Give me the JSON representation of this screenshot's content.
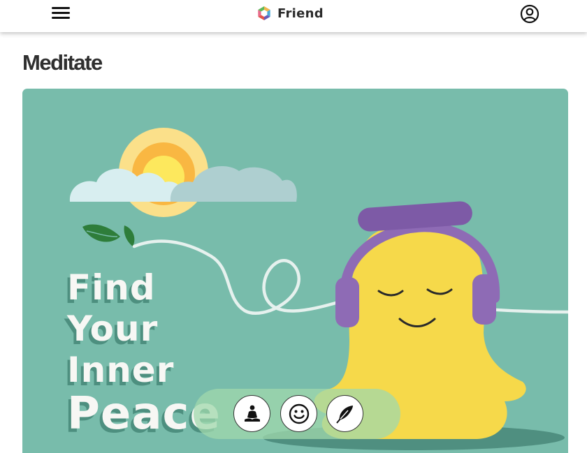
{
  "header": {
    "brand_name": "Friend",
    "menu_icon": "hamburger-menu-icon",
    "account_icon": "user-circle-icon"
  },
  "page": {
    "title": "Meditate"
  },
  "hero": {
    "lines": [
      "Find",
      "Your",
      "Inner",
      "Peace"
    ],
    "colors": {
      "background": "#78bcab",
      "text": "#f7f7f4",
      "character": "#f6d94a",
      "headphones": "#8e6bb5"
    }
  },
  "bottom_nav": {
    "items": [
      {
        "icon": "meditation-icon"
      },
      {
        "icon": "smiley-face-icon"
      },
      {
        "icon": "feather-icon"
      }
    ],
    "pill_color": "#a0d8ac"
  }
}
